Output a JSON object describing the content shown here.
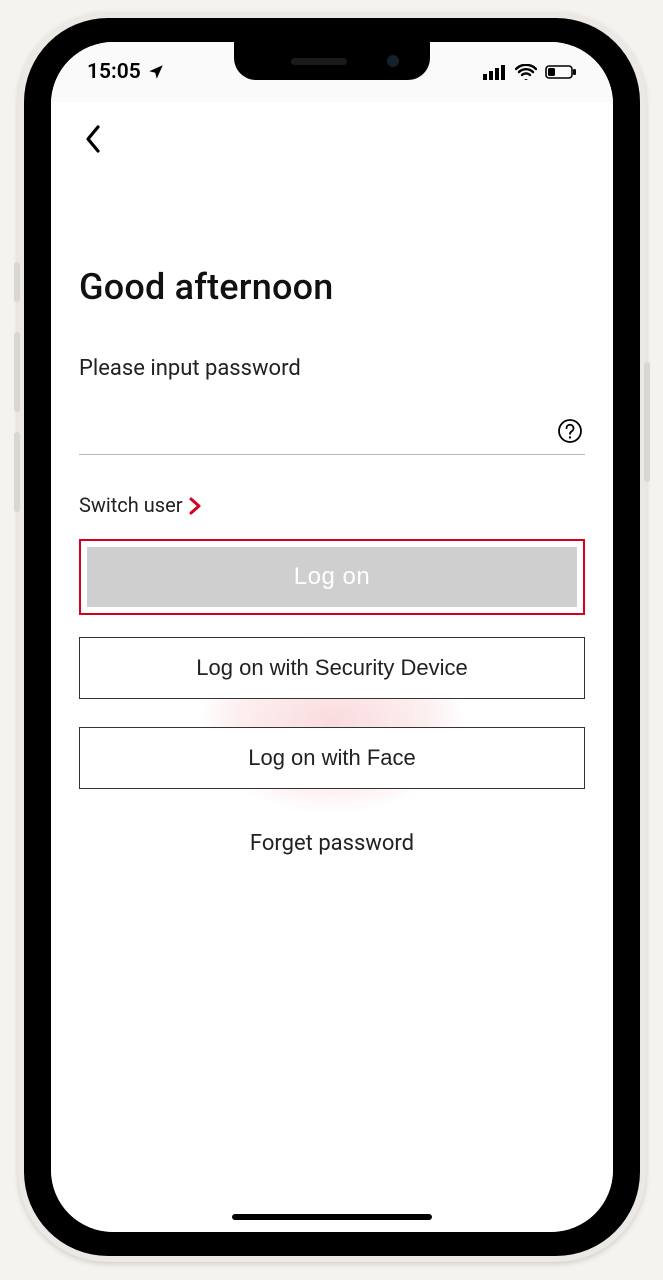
{
  "status": {
    "time": "15:05"
  },
  "screen": {
    "greeting": "Good afternoon",
    "password_prompt": "Please input password",
    "password_value": "",
    "switch_user": "Switch user",
    "primary_btn": "Log on",
    "security_btn": "Log on with Security Device",
    "face_btn": "Log on with Face",
    "forgot": "Forget password"
  },
  "colors": {
    "accent": "#d6001c"
  }
}
